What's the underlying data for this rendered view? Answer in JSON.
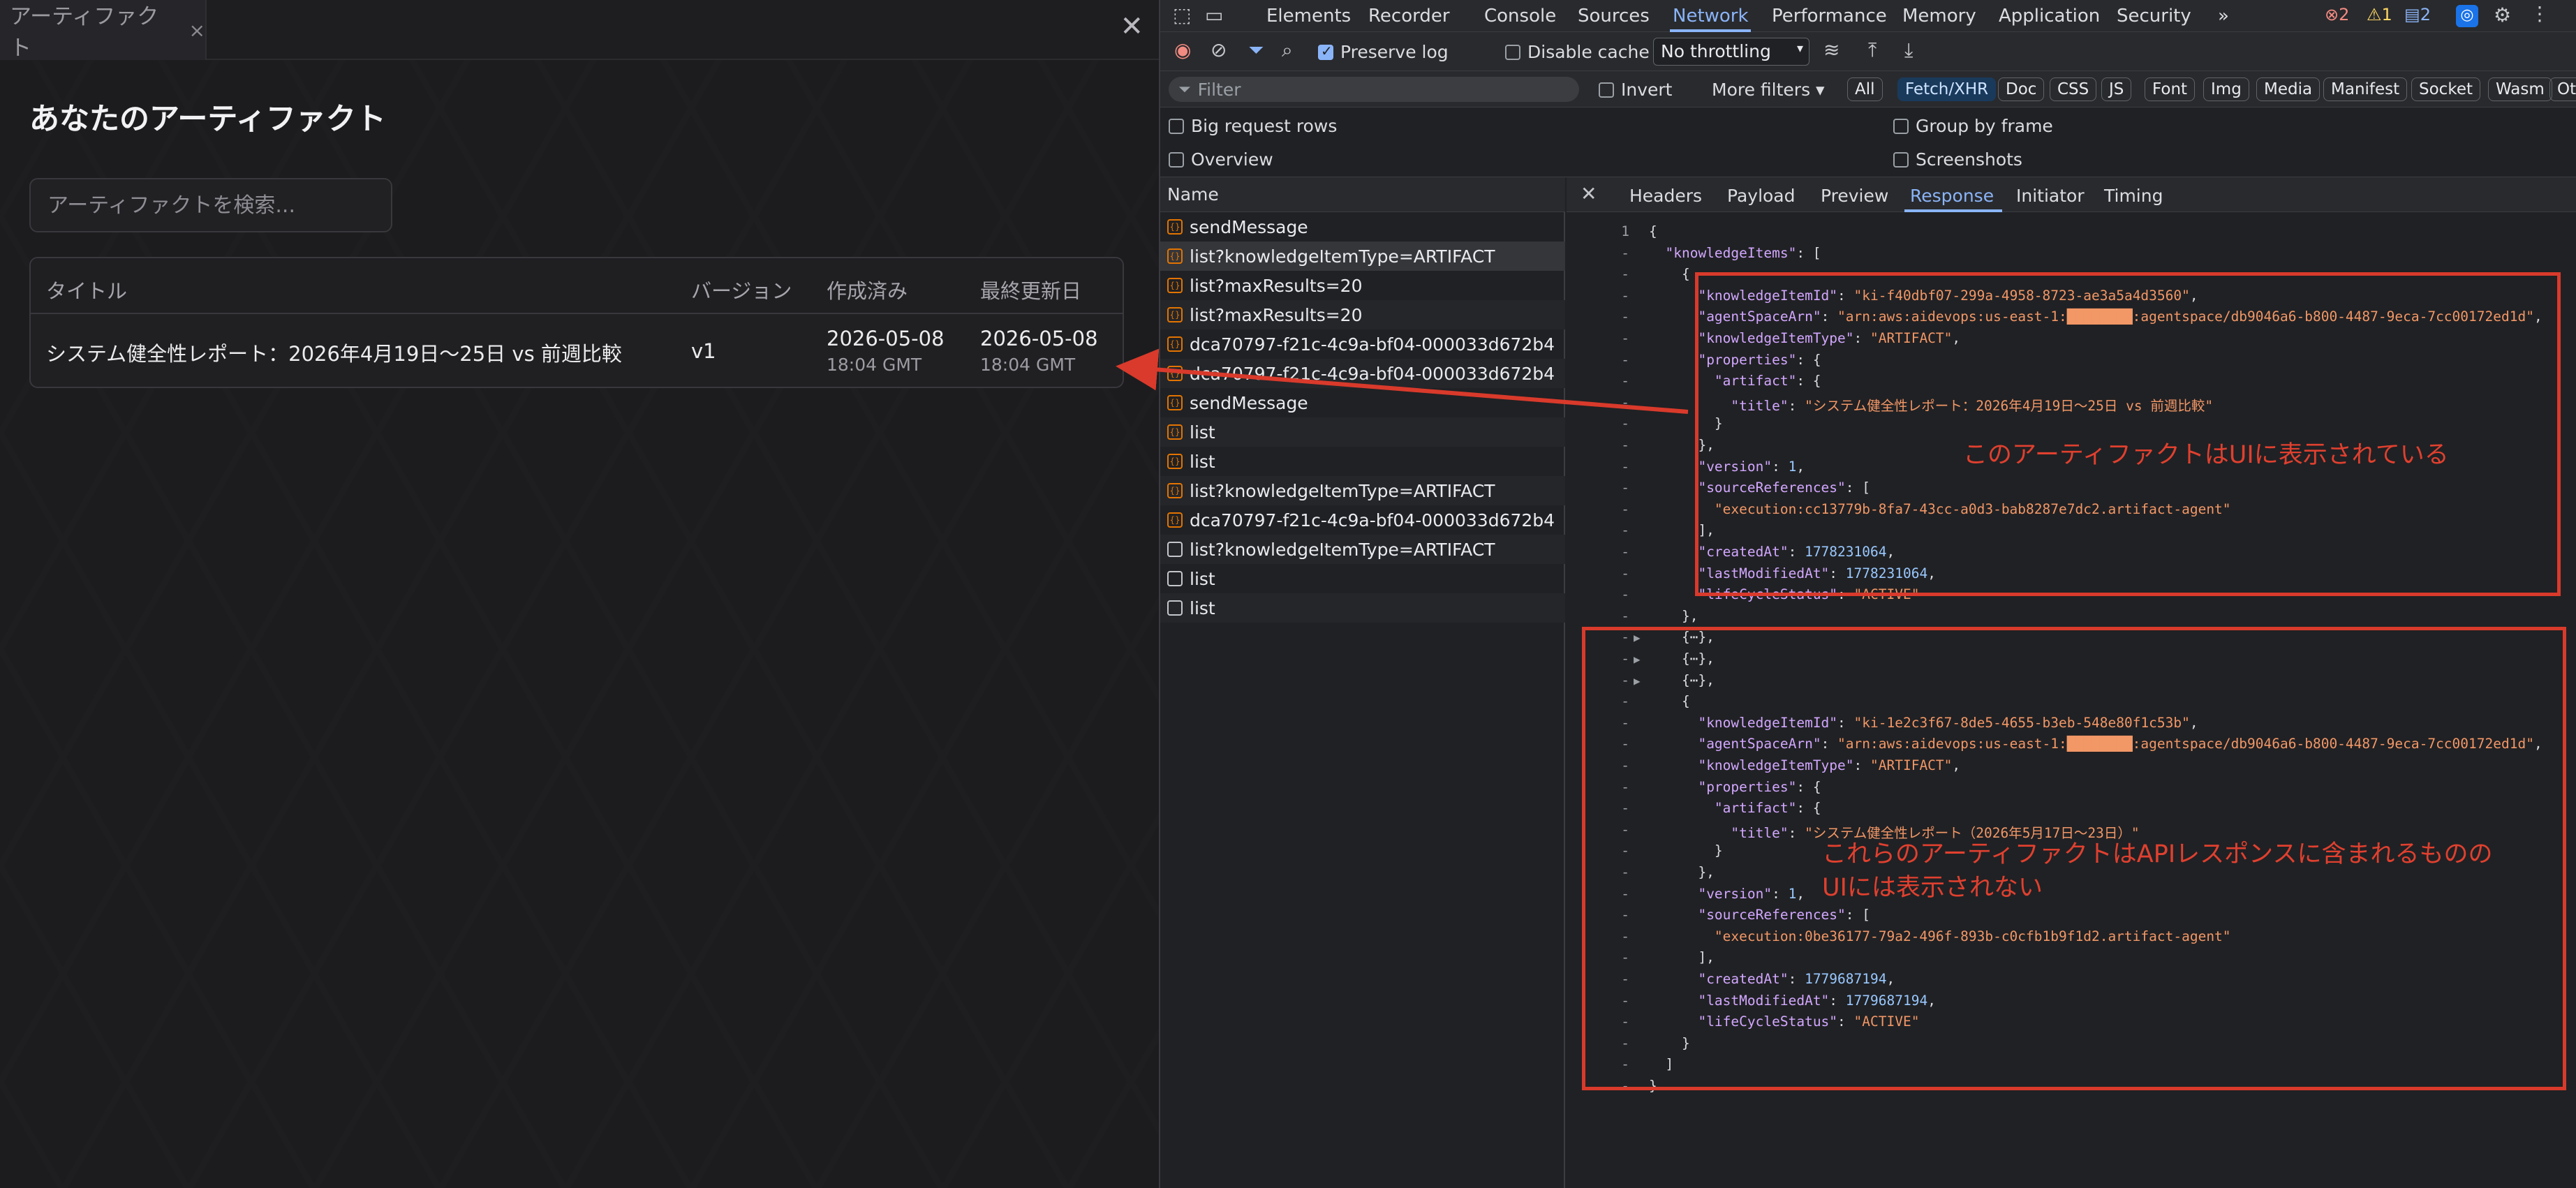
{
  "app": {
    "tab_label": "アーティファクト",
    "tab_close": "×",
    "panel_close": "✕",
    "title": "あなたのアーティファクト",
    "search_placeholder": "アーティファクトを検索...",
    "table": {
      "headers": [
        "タイトル",
        "バージョン",
        "作成済み",
        "最終更新日"
      ],
      "rows": [
        {
          "title": "システム健全性レポート：2026年4月19日〜25日 vs 前週比較",
          "version": "v1",
          "created_date": "2026-05-08",
          "created_time": "18:04 GMT",
          "modified_date": "2026-05-08",
          "modified_time": "18:04 GMT"
        }
      ]
    }
  },
  "devtools": {
    "tabs": [
      "Elements",
      "Recorder",
      "Console",
      "Sources",
      "Network",
      "Performance",
      "Memory",
      "Application",
      "Security"
    ],
    "active_tab": "Network",
    "more_tabs": "»",
    "counts": {
      "errors": "2",
      "warnings": "1",
      "messages": "2"
    },
    "toolbar": {
      "preserve_log": "Preserve log",
      "disable_cache": "Disable cache",
      "throttling": "No throttling"
    },
    "filter": {
      "placeholder": "Filter",
      "invert": "Invert",
      "more_filters": "More filters ▾",
      "chips": [
        "All",
        "Fetch/XHR",
        "Doc",
        "CSS",
        "JS",
        "Font",
        "Img",
        "Media",
        "Manifest",
        "Socket",
        "Wasm",
        "Oth"
      ],
      "active_chip": "Fetch/XHR"
    },
    "options": {
      "big_request_rows": "Big request rows",
      "overview": "Overview",
      "group_by_frame": "Group by frame",
      "screenshots": "Screenshots"
    },
    "requests": {
      "header": "Name",
      "items": [
        {
          "name": "sendMessage",
          "type": "xhr"
        },
        {
          "name": "list?knowledgeItemType=ARTIFACT",
          "type": "xhr"
        },
        {
          "name": "list?maxResults=20",
          "type": "xhr"
        },
        {
          "name": "list?maxResults=20",
          "type": "xhr"
        },
        {
          "name": "dca70797-f21c-4c9a-bf04-000033d672b4",
          "type": "xhr"
        },
        {
          "name": "dca70797-f21c-4c9a-bf04-000033d672b4",
          "type": "xhr"
        },
        {
          "name": "sendMessage",
          "type": "xhr"
        },
        {
          "name": "list",
          "type": "xhr"
        },
        {
          "name": "list",
          "type": "xhr"
        },
        {
          "name": "list?knowledgeItemType=ARTIFACT",
          "type": "xhr"
        },
        {
          "name": "dca70797-f21c-4c9a-bf04-000033d672b4",
          "type": "xhr"
        },
        {
          "name": "list?knowledgeItemType=ARTIFACT",
          "type": "doc"
        },
        {
          "name": "list",
          "type": "doc"
        },
        {
          "name": "list",
          "type": "doc"
        }
      ]
    },
    "response_tabs": [
      "Headers",
      "Payload",
      "Preview",
      "Response",
      "Initiator",
      "Timing"
    ],
    "active_response_tab": "Response",
    "response_lines": [
      {
        "g": "1",
        "t": "{"
      },
      {
        "g": "-",
        "t": "  \"knowledgeItems\": ["
      },
      {
        "g": "-",
        "t": "    {"
      },
      {
        "g": "-",
        "t": "      \"knowledgeItemId\": \"ki-f40dbf07-299a-4958-8723-ae3a5a4d3560\","
      },
      {
        "g": "-",
        "t": "      \"agentSpaceArn\": \"arn:aws:aidevops:us-east-1:████████:agentspace/db9046a6-b800-4487-9eca-7cc00172ed1d\","
      },
      {
        "g": "-",
        "t": "      \"knowledgeItemType\": \"ARTIFACT\","
      },
      {
        "g": "-",
        "t": "      \"properties\": {"
      },
      {
        "g": "-",
        "t": "        \"artifact\": {"
      },
      {
        "g": "-",
        "t": "          \"title\": \"システム健全性レポート：2026年4月19日〜25日 vs 前週比較\""
      },
      {
        "g": "-",
        "t": "        }"
      },
      {
        "g": "-",
        "t": "      },"
      },
      {
        "g": "-",
        "t": "      \"version\": 1,"
      },
      {
        "g": "-",
        "t": "      \"sourceReferences\": ["
      },
      {
        "g": "-",
        "t": "        \"execution:cc13779b-8fa7-43cc-a0d3-bab8287e7dc2.artifact-agent\""
      },
      {
        "g": "-",
        "t": "      ],"
      },
      {
        "g": "-",
        "t": "      \"createdAt\": 1778231064,"
      },
      {
        "g": "-",
        "t": "      \"lastModifiedAt\": 1778231064,"
      },
      {
        "g": "-",
        "t": "      \"lifeCycleStatus\": \"ACTIVE\""
      },
      {
        "g": "-",
        "t": "    },"
      },
      {
        "g": "-",
        "t": "    {⋯},",
        "arrow": true
      },
      {
        "g": "-",
        "t": "    {⋯},",
        "arrow": true
      },
      {
        "g": "-",
        "t": "    {⋯},",
        "arrow": true
      },
      {
        "g": "-",
        "t": "    {"
      },
      {
        "g": "-",
        "t": "      \"knowledgeItemId\": \"ki-1e2c3f67-8de5-4655-b3eb-548e80f1c53b\","
      },
      {
        "g": "-",
        "t": "      \"agentSpaceArn\": \"arn:aws:aidevops:us-east-1:████████:agentspace/db9046a6-b800-4487-9eca-7cc00172ed1d\","
      },
      {
        "g": "-",
        "t": "      \"knowledgeItemType\": \"ARTIFACT\","
      },
      {
        "g": "-",
        "t": "      \"properties\": {"
      },
      {
        "g": "-",
        "t": "        \"artifact\": {"
      },
      {
        "g": "-",
        "t": "          \"title\": \"システム健全性レポート（2026年5月17日〜23日）\""
      },
      {
        "g": "-",
        "t": "        }"
      },
      {
        "g": "-",
        "t": "      },"
      },
      {
        "g": "-",
        "t": "      \"version\": 1,"
      },
      {
        "g": "-",
        "t": "      \"sourceReferences\": ["
      },
      {
        "g": "-",
        "t": "        \"execution:0be36177-79a2-496f-893b-c0cfb1b9f1d2.artifact-agent\""
      },
      {
        "g": "-",
        "t": "      ],"
      },
      {
        "g": "-",
        "t": "      \"createdAt\": 1779687194,"
      },
      {
        "g": "-",
        "t": "      \"lastModifiedAt\": 1779687194,"
      },
      {
        "g": "-",
        "t": "      \"lifeCycleStatus\": \"ACTIVE\""
      },
      {
        "g": "-",
        "t": "    }"
      },
      {
        "g": "-",
        "t": "  ]"
      },
      {
        "g": "-",
        "t": "}"
      }
    ]
  },
  "annotations": {
    "shown_note": "このアーティファクトはUIに表示されている",
    "hidden_note_line1": "これらのアーティファクトはAPIレスポンスに含まれるものの",
    "hidden_note_line2": "UIには表示されない"
  },
  "colors": {
    "accent": "#8ab4f8",
    "annotation": "#d93a2b",
    "json_key": "#d2a7ff",
    "json_string": "#f29766"
  }
}
